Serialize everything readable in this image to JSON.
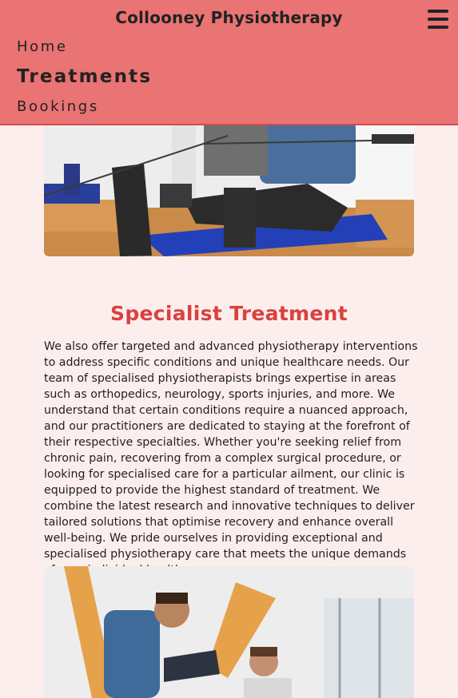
{
  "header": {
    "title": "Collooney Physiotherapy",
    "menu_icon": "hamburger-menu-icon",
    "nav": [
      {
        "label": "Home",
        "active": false
      },
      {
        "label": "Treatments",
        "active": true
      },
      {
        "label": "Bookings",
        "active": false
      }
    ]
  },
  "main": {
    "heading": "Specialist Treatment",
    "paragraph": "We also offer targeted and advanced physiotherapy interventions to address specific conditions and unique healthcare needs. Our team of specialised physiotherapists brings expertise in areas such as orthopedics, neurology, sports injuries, and more. We understand that certain conditions require a nuanced approach, and our practitioners are dedicated to staying at the forefront of their respective specialties. Whether you're seeking relief from chronic pain, recovering from a complex surgical procedure, or looking for specialised care for a particular ailment, our clinic is equipped to provide the highest standard of treatment. We combine the latest research and innovative techniques to deliver tailored solutions that optimise recovery and enhance overall well-being. We pride ourselves in providing exceptional and specialised physiotherapy care that meets the unique demands of your individual health concerns."
  },
  "colors": {
    "header_bg": "#ea7373",
    "accent": "#d9413f",
    "page_bg": "#fdeeee"
  }
}
